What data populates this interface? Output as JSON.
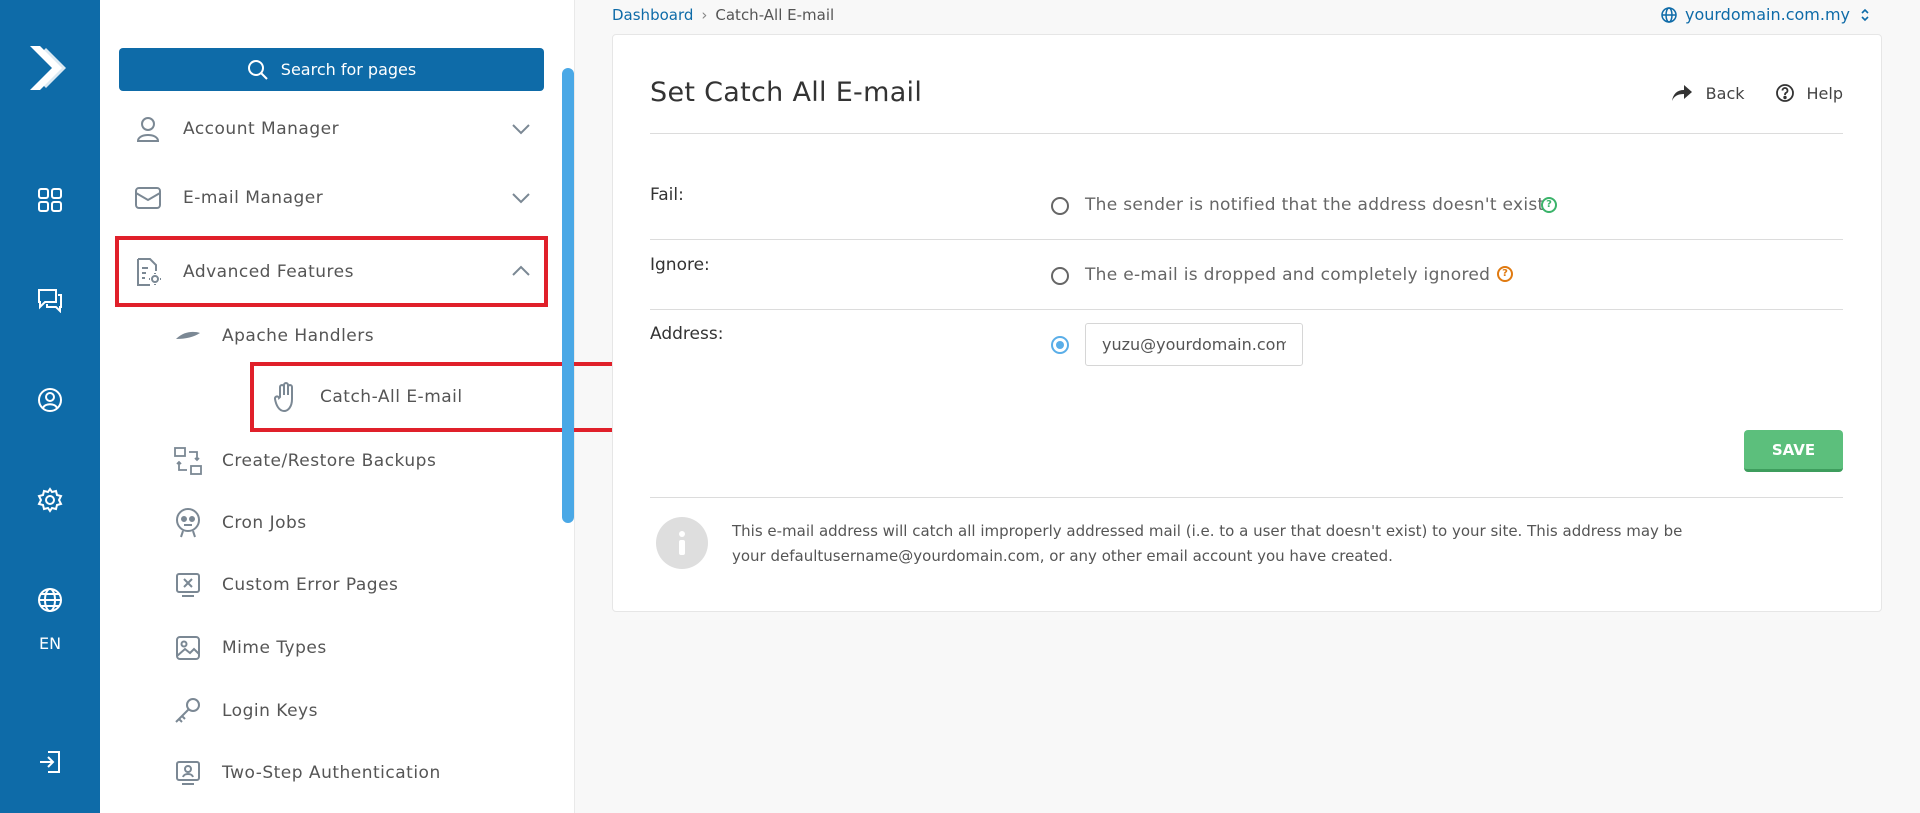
{
  "rail": {
    "icons": [
      "logo-icon",
      "grid-icon",
      "chat-icon",
      "user-circle-icon",
      "gear-icon",
      "globe-icon",
      "logout-icon"
    ],
    "language": "EN"
  },
  "sidebar": {
    "search_label": "Search for pages",
    "items": [
      {
        "label": "Account Manager",
        "icon": "user-icon",
        "expanded": false
      },
      {
        "label": "E-mail Manager",
        "icon": "envelope-icon",
        "expanded": false
      },
      {
        "label": "Advanced Features",
        "icon": "document-gear-icon",
        "expanded": true
      }
    ],
    "sub_items": [
      {
        "label": "Apache Handlers",
        "icon": "feather-icon"
      },
      {
        "label": "Catch-All E-mail",
        "icon": "hand-icon"
      },
      {
        "label": "Create/Restore Backups",
        "icon": "backup-icon"
      },
      {
        "label": "Cron Jobs",
        "icon": "robot-icon"
      },
      {
        "label": "Custom Error Pages",
        "icon": "error-page-icon"
      },
      {
        "label": "Mime Types",
        "icon": "image-icon"
      },
      {
        "label": "Login Keys",
        "icon": "key-icon"
      },
      {
        "label": "Two-Step Authentication",
        "icon": "monitor-user-icon"
      }
    ]
  },
  "breadcrumb": {
    "root": "Dashboard",
    "separator": "›",
    "current": "Catch-All E-mail"
  },
  "domain_selector": {
    "value": "yourdomain.com.my"
  },
  "card": {
    "title": "Set Catch All E-mail",
    "back_label": "Back",
    "help_label": "Help",
    "options": [
      {
        "label": "Fail:",
        "text": "The sender is notified that the address doesn't exist",
        "selected": false,
        "help_color": "#3bb36a"
      },
      {
        "label": "Ignore:",
        "text": "The e-mail is dropped and completely ignored",
        "selected": false,
        "help_color": "#e07a10"
      },
      {
        "label": "Address:",
        "selected": true,
        "value": "yuzu@yourdomain.com.my"
      }
    ],
    "save_label": "SAVE",
    "info": "This e-mail address will catch all improperly addressed mail (i.e. to a user that doesn't exist) to your site. This address may be your defaultusername@yourdomain.com, or any other email account you have created."
  },
  "colors": {
    "brand": "#0e6ba8",
    "save": "#5cbf7c",
    "highlight": "#e0202a"
  }
}
